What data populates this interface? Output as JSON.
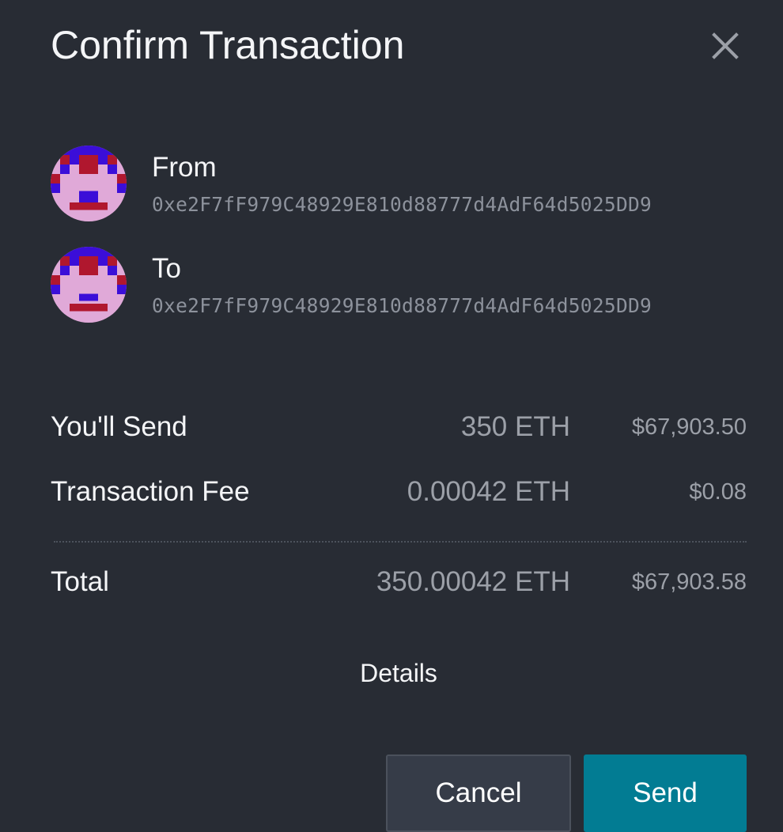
{
  "dialog": {
    "title": "Confirm Transaction",
    "close_icon": "close-icon"
  },
  "from": {
    "label": "From",
    "address": "0xe2F7fF979C48929E810d88777d4AdF64d5025DD9",
    "avatar_icon": "identicon-avatar"
  },
  "to": {
    "label": "To",
    "address": "0xe2F7fF979C48929E810d88777d4AdF64d5025DD9",
    "avatar_icon": "identicon-avatar"
  },
  "summary": {
    "send": {
      "label": "You'll Send",
      "eth": "350 ETH",
      "usd": "$67,903.50"
    },
    "fee": {
      "label": "Transaction Fee",
      "eth": "0.00042 ETH",
      "usd": "$0.08"
    },
    "total": {
      "label": "Total",
      "eth": "350.00042 ETH",
      "usd": "$67,903.58"
    }
  },
  "details_label": "Details",
  "buttons": {
    "cancel": "Cancel",
    "send": "Send"
  },
  "colors": {
    "background": "#282c34",
    "primary_button": "#027c93",
    "secondary_button": "#363c48",
    "identicon_bg": "#e0a9d8",
    "identicon_red": "#b0172e",
    "identicon_blue": "#3b0ed8"
  }
}
